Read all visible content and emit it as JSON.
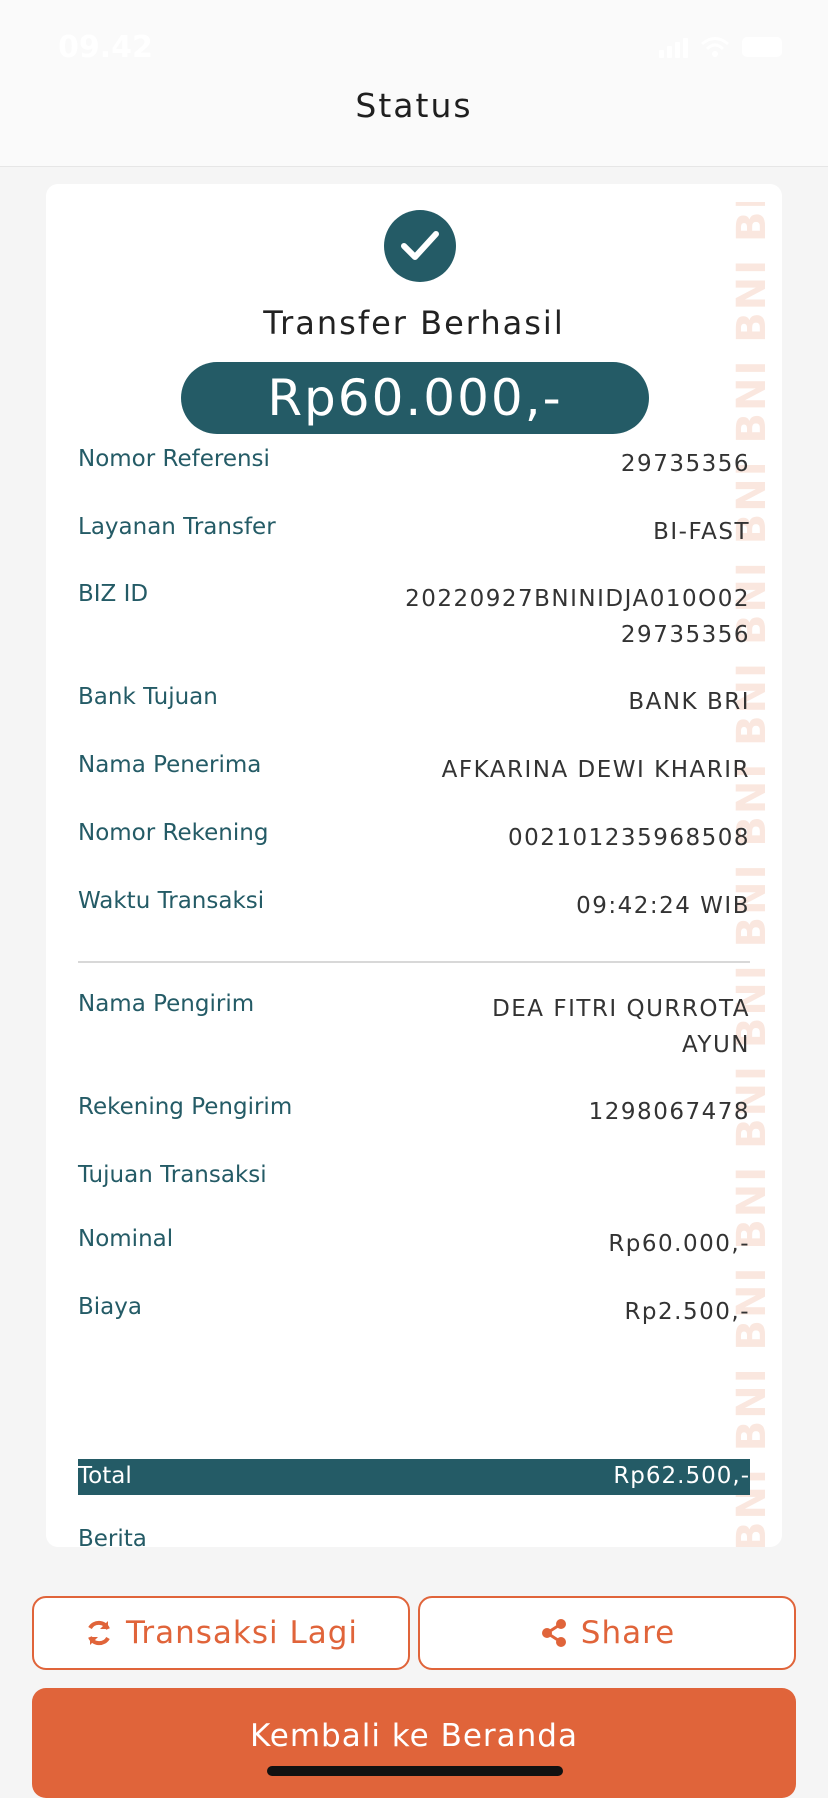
{
  "status_bar": {
    "time": "09.42"
  },
  "header": {
    "title": "Status"
  },
  "receipt": {
    "headline": "Transfer Berhasil",
    "amount": "Rp60.000,-",
    "watermark": "BNI BNI BNI BNI BNI BNI BNI BNI BNI BNI BNI BNI BNI BNI",
    "rows": [
      {
        "label": "Nomor Referensi",
        "value": "29735356"
      },
      {
        "label": "Layanan Transfer",
        "value": "BI-FAST"
      },
      {
        "label": "BIZ ID",
        "value": "20220927BNINIDJA010O0229735356"
      },
      {
        "label": "Bank Tujuan",
        "value": "BANK BRI"
      },
      {
        "label": "Nama Penerima",
        "value": "AFKARINA DEWI KHARIR"
      },
      {
        "label": "Nomor Rekening",
        "value": "002101235968508"
      },
      {
        "label": "Waktu Transaksi",
        "value": "09:42:24 WIB"
      },
      {
        "label": "Nama Pengirim",
        "value": "DEA FITRI QURROTA AYUN"
      },
      {
        "label": "Rekening Pengirim",
        "value": "1298067478"
      },
      {
        "label": "Tujuan Transaksi",
        "value": ""
      },
      {
        "label": "Nominal",
        "value": "Rp60.000,-"
      },
      {
        "label": "Biaya",
        "value": "Rp2.500,-"
      }
    ],
    "total": {
      "label": "Total",
      "value": "Rp62.500,-"
    },
    "note": {
      "label": "Berita",
      "value": ""
    }
  },
  "actions": {
    "repeat_label": "Transaksi Lagi",
    "share_label": "Share",
    "home_label": "Kembali ke Beranda"
  },
  "colors": {
    "primary": "#245b66",
    "accent": "#e0643a"
  }
}
